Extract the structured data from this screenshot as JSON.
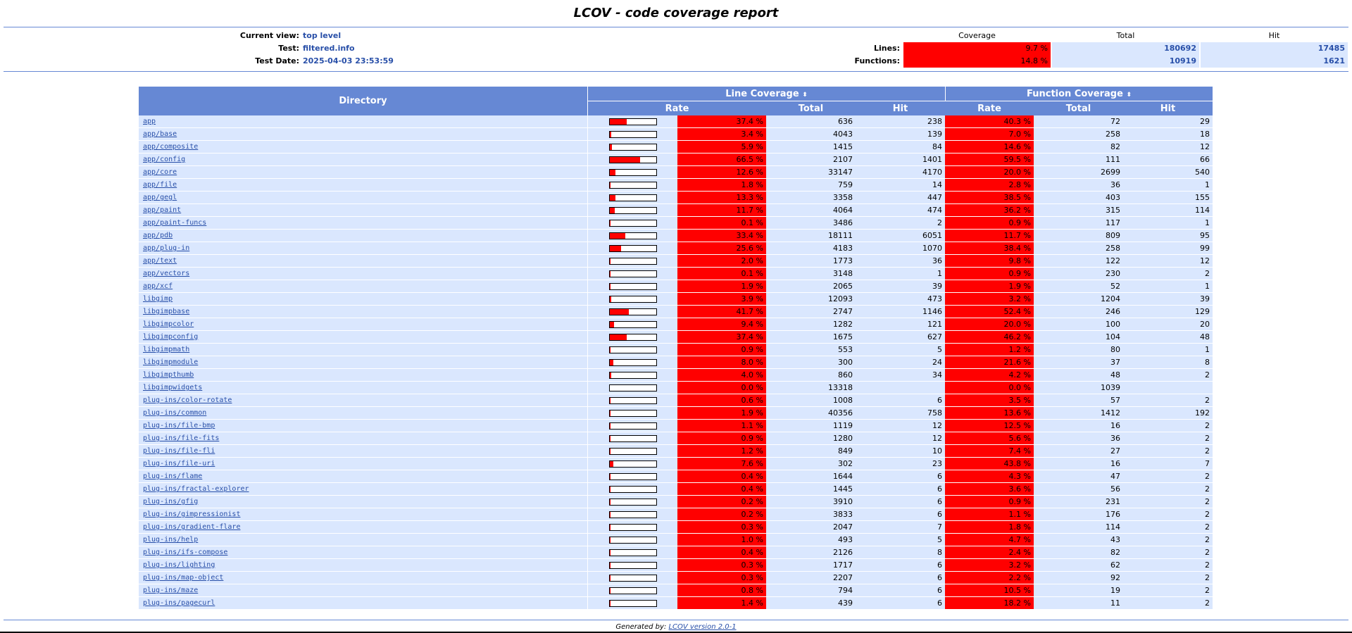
{
  "title": "LCOV - code coverage report",
  "header": {
    "current_view_label": "Current view:",
    "current_view": "top level",
    "test_label": "Test:",
    "test": "filtered.info",
    "test_date_label": "Test Date:",
    "test_date": "2025-04-03 23:53:59"
  },
  "summary": {
    "col_coverage": "Coverage",
    "col_total": "Total",
    "col_hit": "Hit",
    "lines_label": "Lines:",
    "lines_coverage": "9.7 %",
    "lines_total": "180692",
    "lines_hit": "17485",
    "functions_label": "Functions:",
    "functions_coverage": "14.8 %",
    "functions_total": "10919",
    "functions_hit": "1621"
  },
  "table": {
    "col_directory": "Directory",
    "col_line_coverage": "Line Coverage",
    "col_function_coverage": "Function Coverage",
    "col_rate": "Rate",
    "col_total": "Total",
    "col_hit": "Hit",
    "sort_icon": "sort-arrows-icon",
    "rows": [
      {
        "dir": "app",
        "line_pct": 37.4,
        "line_rate": "37.4 %",
        "line_total": "636",
        "line_hit": "238",
        "func_rate": "40.3 %",
        "func_total": "72",
        "func_hit": "29"
      },
      {
        "dir": "app/base",
        "line_pct": 3.4,
        "line_rate": "3.4 %",
        "line_total": "4043",
        "line_hit": "139",
        "func_rate": "7.0 %",
        "func_total": "258",
        "func_hit": "18"
      },
      {
        "dir": "app/composite",
        "line_pct": 5.9,
        "line_rate": "5.9 %",
        "line_total": "1415",
        "line_hit": "84",
        "func_rate": "14.6 %",
        "func_total": "82",
        "func_hit": "12"
      },
      {
        "dir": "app/config",
        "line_pct": 66.5,
        "line_rate": "66.5 %",
        "line_total": "2107",
        "line_hit": "1401",
        "func_rate": "59.5 %",
        "func_total": "111",
        "func_hit": "66"
      },
      {
        "dir": "app/core",
        "line_pct": 12.6,
        "line_rate": "12.6 %",
        "line_total": "33147",
        "line_hit": "4170",
        "func_rate": "20.0 %",
        "func_total": "2699",
        "func_hit": "540"
      },
      {
        "dir": "app/file",
        "line_pct": 1.8,
        "line_rate": "1.8 %",
        "line_total": "759",
        "line_hit": "14",
        "func_rate": "2.8 %",
        "func_total": "36",
        "func_hit": "1"
      },
      {
        "dir": "app/gegl",
        "line_pct": 13.3,
        "line_rate": "13.3 %",
        "line_total": "3358",
        "line_hit": "447",
        "func_rate": "38.5 %",
        "func_total": "403",
        "func_hit": "155"
      },
      {
        "dir": "app/paint",
        "line_pct": 11.7,
        "line_rate": "11.7 %",
        "line_total": "4064",
        "line_hit": "474",
        "func_rate": "36.2 %",
        "func_total": "315",
        "func_hit": "114"
      },
      {
        "dir": "app/paint-funcs",
        "line_pct": 0.1,
        "line_rate": "0.1 %",
        "line_total": "3486",
        "line_hit": "2",
        "func_rate": "0.9 %",
        "func_total": "117",
        "func_hit": "1"
      },
      {
        "dir": "app/pdb",
        "line_pct": 33.4,
        "line_rate": "33.4 %",
        "line_total": "18111",
        "line_hit": "6051",
        "func_rate": "11.7 %",
        "func_total": "809",
        "func_hit": "95"
      },
      {
        "dir": "app/plug-in",
        "line_pct": 25.6,
        "line_rate": "25.6 %",
        "line_total": "4183",
        "line_hit": "1070",
        "func_rate": "38.4 %",
        "func_total": "258",
        "func_hit": "99"
      },
      {
        "dir": "app/text",
        "line_pct": 2.0,
        "line_rate": "2.0 %",
        "line_total": "1773",
        "line_hit": "36",
        "func_rate": "9.8 %",
        "func_total": "122",
        "func_hit": "12"
      },
      {
        "dir": "app/vectors",
        "line_pct": 0.1,
        "line_rate": "0.1 %",
        "line_total": "3148",
        "line_hit": "1",
        "func_rate": "0.9 %",
        "func_total": "230",
        "func_hit": "2"
      },
      {
        "dir": "app/xcf",
        "line_pct": 1.9,
        "line_rate": "1.9 %",
        "line_total": "2065",
        "line_hit": "39",
        "func_rate": "1.9 %",
        "func_total": "52",
        "func_hit": "1"
      },
      {
        "dir": "libgimp",
        "line_pct": 3.9,
        "line_rate": "3.9 %",
        "line_total": "12093",
        "line_hit": "473",
        "func_rate": "3.2 %",
        "func_total": "1204",
        "func_hit": "39"
      },
      {
        "dir": "libgimpbase",
        "line_pct": 41.7,
        "line_rate": "41.7 %",
        "line_total": "2747",
        "line_hit": "1146",
        "func_rate": "52.4 %",
        "func_total": "246",
        "func_hit": "129"
      },
      {
        "dir": "libgimpcolor",
        "line_pct": 9.4,
        "line_rate": "9.4 %",
        "line_total": "1282",
        "line_hit": "121",
        "func_rate": "20.0 %",
        "func_total": "100",
        "func_hit": "20"
      },
      {
        "dir": "libgimpconfig",
        "line_pct": 37.4,
        "line_rate": "37.4 %",
        "line_total": "1675",
        "line_hit": "627",
        "func_rate": "46.2 %",
        "func_total": "104",
        "func_hit": "48"
      },
      {
        "dir": "libgimpmath",
        "line_pct": 0.9,
        "line_rate": "0.9 %",
        "line_total": "553",
        "line_hit": "5",
        "func_rate": "1.2 %",
        "func_total": "80",
        "func_hit": "1"
      },
      {
        "dir": "libgimpmodule",
        "line_pct": 8.0,
        "line_rate": "8.0 %",
        "line_total": "300",
        "line_hit": "24",
        "func_rate": "21.6 %",
        "func_total": "37",
        "func_hit": "8"
      },
      {
        "dir": "libgimpthumb",
        "line_pct": 4.0,
        "line_rate": "4.0 %",
        "line_total": "860",
        "line_hit": "34",
        "func_rate": "4.2 %",
        "func_total": "48",
        "func_hit": "2"
      },
      {
        "dir": "libgimpwidgets",
        "line_pct": 0.0,
        "line_rate": "0.0 %",
        "line_total": "13318",
        "line_hit": "",
        "func_rate": "0.0 %",
        "func_total": "1039",
        "func_hit": ""
      },
      {
        "dir": "plug-ins/color-rotate",
        "line_pct": 0.6,
        "line_rate": "0.6 %",
        "line_total": "1008",
        "line_hit": "6",
        "func_rate": "3.5 %",
        "func_total": "57",
        "func_hit": "2"
      },
      {
        "dir": "plug-ins/common",
        "line_pct": 1.9,
        "line_rate": "1.9 %",
        "line_total": "40356",
        "line_hit": "758",
        "func_rate": "13.6 %",
        "func_total": "1412",
        "func_hit": "192"
      },
      {
        "dir": "plug-ins/file-bmp",
        "line_pct": 1.1,
        "line_rate": "1.1 %",
        "line_total": "1119",
        "line_hit": "12",
        "func_rate": "12.5 %",
        "func_total": "16",
        "func_hit": "2"
      },
      {
        "dir": "plug-ins/file-fits",
        "line_pct": 0.9,
        "line_rate": "0.9 %",
        "line_total": "1280",
        "line_hit": "12",
        "func_rate": "5.6 %",
        "func_total": "36",
        "func_hit": "2"
      },
      {
        "dir": "plug-ins/file-fli",
        "line_pct": 1.2,
        "line_rate": "1.2 %",
        "line_total": "849",
        "line_hit": "10",
        "func_rate": "7.4 %",
        "func_total": "27",
        "func_hit": "2"
      },
      {
        "dir": "plug-ins/file-uri",
        "line_pct": 7.6,
        "line_rate": "7.6 %",
        "line_total": "302",
        "line_hit": "23",
        "func_rate": "43.8 %",
        "func_total": "16",
        "func_hit": "7"
      },
      {
        "dir": "plug-ins/flame",
        "line_pct": 0.4,
        "line_rate": "0.4 %",
        "line_total": "1644",
        "line_hit": "6",
        "func_rate": "4.3 %",
        "func_total": "47",
        "func_hit": "2"
      },
      {
        "dir": "plug-ins/fractal-explorer",
        "line_pct": 0.4,
        "line_rate": "0.4 %",
        "line_total": "1445",
        "line_hit": "6",
        "func_rate": "3.6 %",
        "func_total": "56",
        "func_hit": "2"
      },
      {
        "dir": "plug-ins/gfig",
        "line_pct": 0.2,
        "line_rate": "0.2 %",
        "line_total": "3910",
        "line_hit": "6",
        "func_rate": "0.9 %",
        "func_total": "231",
        "func_hit": "2"
      },
      {
        "dir": "plug-ins/gimpressionist",
        "line_pct": 0.2,
        "line_rate": "0.2 %",
        "line_total": "3833",
        "line_hit": "6",
        "func_rate": "1.1 %",
        "func_total": "176",
        "func_hit": "2"
      },
      {
        "dir": "plug-ins/gradient-flare",
        "line_pct": 0.3,
        "line_rate": "0.3 %",
        "line_total": "2047",
        "line_hit": "7",
        "func_rate": "1.8 %",
        "func_total": "114",
        "func_hit": "2"
      },
      {
        "dir": "plug-ins/help",
        "line_pct": 1.0,
        "line_rate": "1.0 %",
        "line_total": "493",
        "line_hit": "5",
        "func_rate": "4.7 %",
        "func_total": "43",
        "func_hit": "2"
      },
      {
        "dir": "plug-ins/ifs-compose",
        "line_pct": 0.4,
        "line_rate": "0.4 %",
        "line_total": "2126",
        "line_hit": "8",
        "func_rate": "2.4 %",
        "func_total": "82",
        "func_hit": "2"
      },
      {
        "dir": "plug-ins/lighting",
        "line_pct": 0.3,
        "line_rate": "0.3 %",
        "line_total": "1717",
        "line_hit": "6",
        "func_rate": "3.2 %",
        "func_total": "62",
        "func_hit": "2"
      },
      {
        "dir": "plug-ins/map-object",
        "line_pct": 0.3,
        "line_rate": "0.3 %",
        "line_total": "2207",
        "line_hit": "6",
        "func_rate": "2.2 %",
        "func_total": "92",
        "func_hit": "2"
      },
      {
        "dir": "plug-ins/maze",
        "line_pct": 0.8,
        "line_rate": "0.8 %",
        "line_total": "794",
        "line_hit": "6",
        "func_rate": "10.5 %",
        "func_total": "19",
        "func_hit": "2"
      },
      {
        "dir": "plug-ins/pagecurl",
        "line_pct": 1.4,
        "line_rate": "1.4 %",
        "line_total": "439",
        "line_hit": "6",
        "func_rate": "18.2 %",
        "func_total": "11",
        "func_hit": "2"
      }
    ]
  },
  "footer": {
    "generated_by": "Generated by:",
    "lcov_link": "LCOV version 2.0-1"
  },
  "colors": {
    "accent": "#6688d4",
    "low_coverage": "#ff0000",
    "row_background": "#dae7fe",
    "link": "#284fa8"
  }
}
